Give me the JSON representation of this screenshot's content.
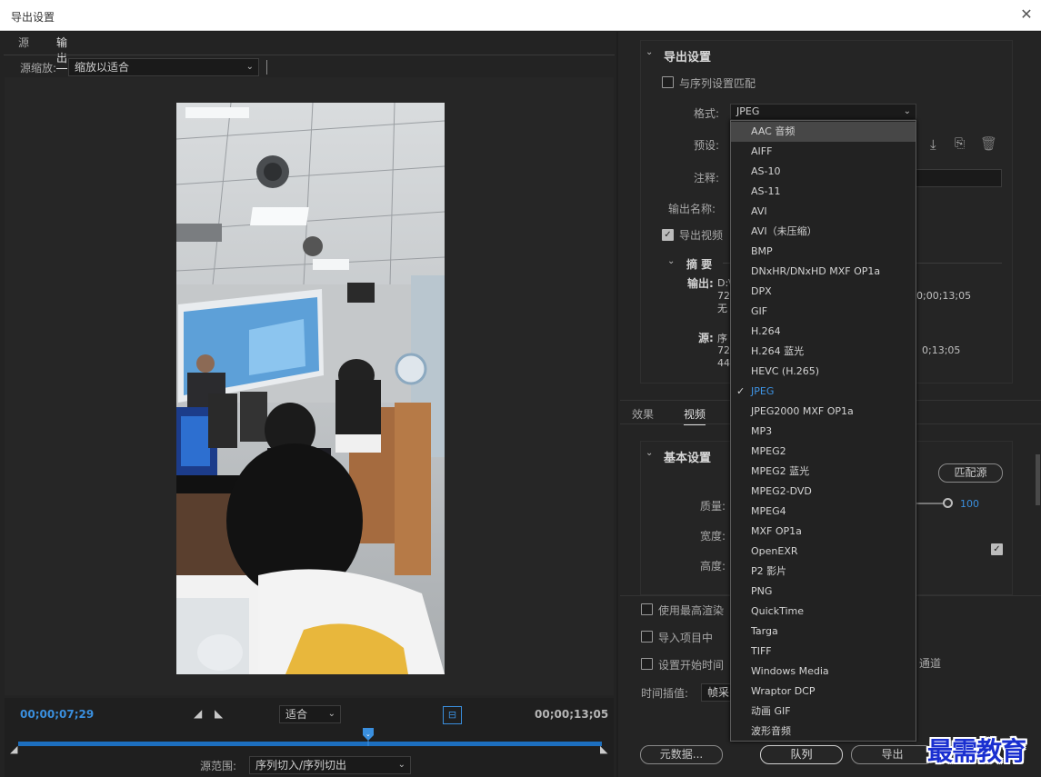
{
  "window": {
    "title": "导出设置",
    "close": "✕"
  },
  "left": {
    "tabs": [
      "源",
      "输出"
    ],
    "active_tab": "输出",
    "zoom_label": "源缩放:",
    "zoom_value": "缩放以适合",
    "timeline": {
      "current_tc": "00;00;07;29",
      "end_tc": "00;00;13;05",
      "fit_value": "适合",
      "source_range_label": "源范围:",
      "source_range_value": "序列切入/序列切出",
      "playhead_fraction": 0.6
    }
  },
  "export": {
    "section_title": "导出设置",
    "match_sequence_label": "与序列设置匹配",
    "format_label": "格式:",
    "format_value": "JPEG",
    "preset_label": "预设:",
    "comment_label": "注释:",
    "output_name_label": "输出名称:",
    "export_video_label": "导出视频",
    "summary_title": "摘 要",
    "output_label": "输出:",
    "output_lines": [
      "D:\\",
      "720",
      "无"
    ],
    "output_tc": "0;00;13;05",
    "source_label": "源:",
    "source_lines": [
      "序",
      "720",
      "441"
    ],
    "source_tc": "0;13;05"
  },
  "lower_tabs": [
    "效果",
    "视频"
  ],
  "lower_active_tab": "视频",
  "basic": {
    "section_title": "基本设置",
    "match_source_button": "匹配源",
    "quality_label": "质量:",
    "quality_value": "100",
    "width_label": "宽度:",
    "height_label": "高度:"
  },
  "bottom": {
    "max_render_label": "使用最高渲染",
    "import_project_label": "导入项目中",
    "set_start_label": "设置开始时间",
    "channel_fragment": "通道",
    "time_interp_label": "时间插值:",
    "time_interp_value": "帧采",
    "metadata_button": "元数据...",
    "queue_button": "队列",
    "export_button": "导出"
  },
  "format_dropdown": {
    "options": [
      "AAC 音频",
      "AIFF",
      "AS-10",
      "AS-11",
      "AVI",
      "AVI（未压缩）",
      "BMP",
      "DNxHR/DNxHD MXF OP1a",
      "DPX",
      "GIF",
      "H.264",
      "H.264 蓝光",
      "HEVC (H.265)",
      "JPEG",
      "JPEG2000 MXF OP1a",
      "MP3",
      "MPEG2",
      "MPEG2 蓝光",
      "MPEG2-DVD",
      "MPEG4",
      "MXF OP1a",
      "OpenEXR",
      "P2 影片",
      "PNG",
      "QuickTime",
      "Targa",
      "TIFF",
      "Windows Media",
      "Wraptor DCP",
      "动画 GIF",
      "波形音频"
    ],
    "selected": "JPEG",
    "hovered": "AAC 音频"
  },
  "watermark": "最需教育",
  "colors": {
    "accent_blue": "#3a8fde",
    "watermark_blue": "#1a2fd0"
  }
}
